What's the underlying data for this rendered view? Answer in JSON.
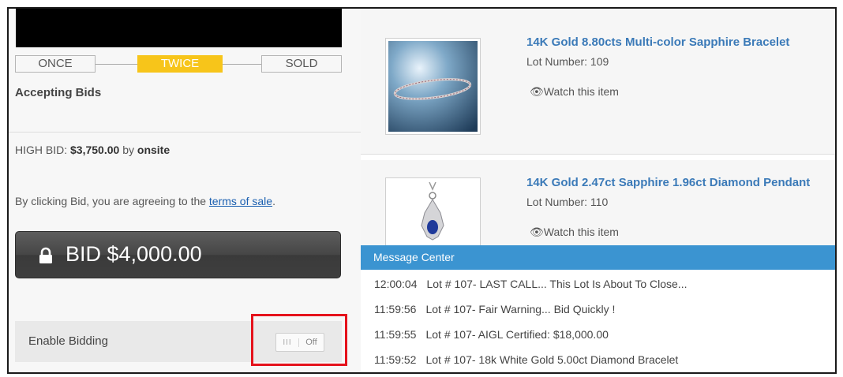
{
  "stages": {
    "once": "ONCE",
    "twice": "TWICE",
    "sold": "SOLD",
    "active": "TWICE"
  },
  "status_text": "Accepting Bids",
  "high_bid": {
    "label": "HIGH BID:",
    "amount": "$3,750.00",
    "by_word": "by",
    "bidder": "onsite"
  },
  "terms": {
    "prefix": "By clicking Bid, you are agreeing to the",
    "link": "terms of sale",
    "suffix": "."
  },
  "bid_button": {
    "label": "BID $4,000.00",
    "icon": "lock-icon"
  },
  "enable_bidding": {
    "label": "Enable Bidding",
    "toggle_grip": "III",
    "toggle_state": "Off"
  },
  "lots": [
    {
      "title": "14K Gold 8.80cts Multi-color Sapphire Bracelet",
      "lot_number": "Lot Number: 109",
      "watch": "Watch this item",
      "image": "sapphire-bracelet"
    },
    {
      "title": "14K Gold 2.47ct Sapphire 1.96ct Diamond Pendant",
      "lot_number": "Lot Number: 110",
      "watch": "Watch this item",
      "image": "sapphire-diamond-pendant"
    }
  ],
  "message_center": {
    "title": "Message Center",
    "messages": [
      {
        "time": "12:00:04",
        "text": "Lot # 107- LAST CALL... This Lot Is About To Close..."
      },
      {
        "time": "11:59:56",
        "text": "Lot # 107- Fair Warning... Bid Quickly !"
      },
      {
        "time": "11:59:55",
        "text": "Lot # 107- AIGL Certified: $18,000.00"
      },
      {
        "time": "11:59:52",
        "text": "Lot # 107- 18k White Gold 5.00ct Diamond Bracelet"
      }
    ]
  },
  "colors": {
    "accent_yellow": "#f7c51a",
    "link_blue": "#3b7ab8",
    "header_blue": "#3b94d1",
    "highlight_red": "#e5121c"
  }
}
